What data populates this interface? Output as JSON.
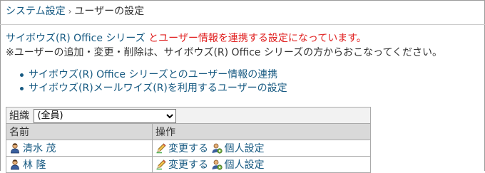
{
  "breadcrumb": {
    "parent": "システム設定",
    "separator": "›",
    "current": "ユーザーの設定"
  },
  "notice": {
    "link_text": "サイボウズ(R) Office シリーズ",
    "warning_text": "とユーザー情報を連携する設定になっています。",
    "info_text": "※ユーザーの追加・変更・削除は、サイボウズ(R) Office シリーズの方からおこなってください。"
  },
  "links": [
    {
      "label": "サイボウズ(R) Office シリーズとのユーザー情報の連携"
    },
    {
      "label": "サイボウズ(R)メールワイズ(R)を利用するユーザーの設定"
    }
  ],
  "table": {
    "filter_label": "組織",
    "filter_selected": "(全員)",
    "headers": [
      "名前",
      "操作"
    ],
    "rows": [
      {
        "name": "清水 茂",
        "edit_label": "変更する",
        "personal_label": "個人設定"
      },
      {
        "name": "林 隆",
        "edit_label": "変更する",
        "personal_label": "個人設定"
      }
    ]
  },
  "colors": {
    "link": "#175a82",
    "warning": "#e02020",
    "header_bg": "#d9d9d9"
  },
  "icons": {
    "user": "user-icon",
    "edit": "pencil-icon",
    "personal": "personal-settings-icon"
  }
}
